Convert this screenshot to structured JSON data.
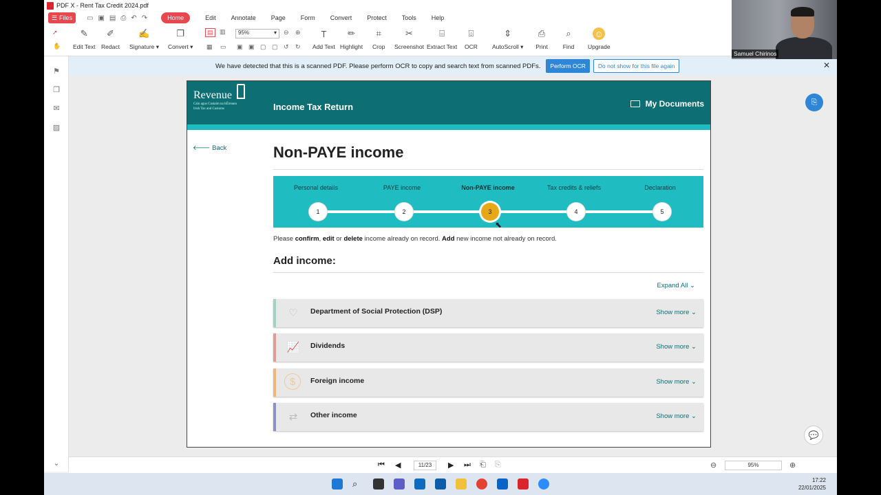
{
  "window": {
    "title": "PDF X - Rent Tax Credit 2024.pdf"
  },
  "menubar": {
    "files_label": "Files",
    "items": [
      "Home",
      "Edit",
      "Annotate",
      "Page",
      "Form",
      "Convert",
      "Protect",
      "Tools",
      "Help"
    ],
    "active": "Home"
  },
  "toolbar": {
    "zoom_value": "95%",
    "tools": [
      "Edit Text",
      "Redact",
      "Signature ▾",
      "Convert ▾",
      "Add Text",
      "Highlight",
      "Crop",
      "Screenshot",
      "Extract Text",
      "OCR",
      "AutoScroll ▾",
      "Print",
      "Find",
      "Upgrade"
    ]
  },
  "ocr_banner": {
    "message": "We have detected that this is a scanned PDF.  Please perform OCR to copy and search text from scanned PDFs.",
    "perform_label": "Perform OCR",
    "dismiss_label": "Do not show for this file again",
    "close_icon": "close-icon"
  },
  "document": {
    "header": {
      "logo_text": "Revenue",
      "logo_subtitle_1": "Cáin agus Custaim na hÉireann",
      "logo_subtitle_2": "Irish Tax and Customs",
      "title": "Income Tax Return",
      "my_documents": "My Documents"
    },
    "back_label": "Back",
    "heading": "Non-PAYE income",
    "steps": [
      {
        "label": "Personal details",
        "number": "1"
      },
      {
        "label": "PAYE income",
        "number": "2"
      },
      {
        "label": "Non-PAYE income",
        "number": "3"
      },
      {
        "label": "Tax credits & reliefs",
        "number": "4"
      },
      {
        "label": "Declaration",
        "number": "5"
      }
    ],
    "current_step": 3,
    "instruction": {
      "p1": "Please ",
      "b1": "confirm",
      "p2": ", ",
      "b2": "edit",
      "p3": " or ",
      "b3": "delete",
      "p4": " income already on record. ",
      "b4": "Add",
      "p5": " new income not already on record."
    },
    "add_income_heading": "Add income:",
    "expand_all": "Expand All",
    "income_cards": [
      {
        "title": "Department of Social Protection (DSP)",
        "more": "Show more",
        "accent": "#9fd3c7",
        "icon": "hand-heart-icon"
      },
      {
        "title": "Dividends",
        "more": "Show more",
        "accent": "#e39a9a",
        "icon": "chart-line-icon"
      },
      {
        "title": "Foreign income",
        "more": "Show more",
        "accent": "#f0b77c",
        "icon": "dollar-coin-icon"
      },
      {
        "title": "Other income",
        "more": "Show more",
        "accent": "#8e8fc4",
        "icon": "exchange-icon"
      }
    ]
  },
  "navigation": {
    "page_indicator": "11/23",
    "zoom_value": "95%"
  },
  "webcam": {
    "name": "Samuel Chirinos"
  },
  "taskbar": {
    "time": "17:22",
    "date": "22/01/2025"
  },
  "colors": {
    "revenue_teal": "#0d6e73",
    "stepper_cyan": "#1fbdc1",
    "current_step": "#e6a816",
    "app_accent": "#e8474e"
  }
}
